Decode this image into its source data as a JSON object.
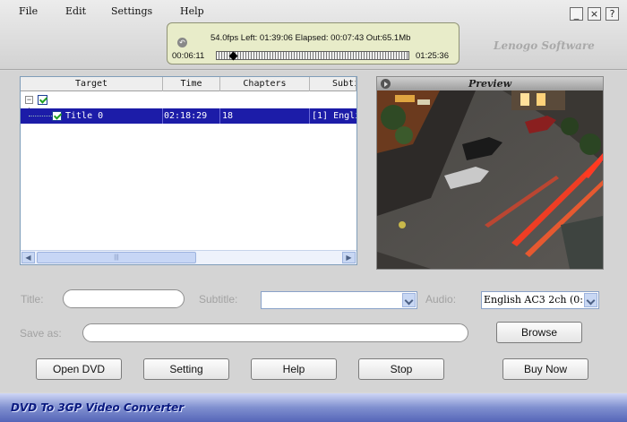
{
  "menu": {
    "file": "File",
    "edit": "Edit",
    "settings": "Settings",
    "help": "Help"
  },
  "window": {
    "minimize": "_",
    "close": "×",
    "help": "?"
  },
  "brand": "Lenogo Software",
  "player": {
    "status": "54.0fps Left: 01:39:06 Elapsed: 00:07:43 Out:65.1Mb",
    "elapsed_time": "00:06:11",
    "total_time": "01:25:36",
    "progress": 0.07
  },
  "table": {
    "columns": [
      "Target",
      "Time",
      "Chapters",
      "Subti"
    ],
    "rows": [
      {
        "target": "Title 0",
        "time": "02:18:29",
        "chapters": "18",
        "subtitle": "[1] Engli"
      }
    ]
  },
  "preview": {
    "title": "Preview"
  },
  "form": {
    "title_label": "Title:",
    "title_value": "",
    "subtitle_label": "Subtitle:",
    "subtitle_value": "",
    "audio_label": "Audio:",
    "audio_value": "English AC3 2ch (0:",
    "saveas_label": "Save as:",
    "saveas_value": ""
  },
  "buttons": {
    "browse": "Browse",
    "open_dvd": "Open DVD",
    "setting": "Setting",
    "help": "Help",
    "stop": "Stop",
    "buy_now": "Buy Now"
  },
  "app_title": "DVD To 3GP Video Converter"
}
